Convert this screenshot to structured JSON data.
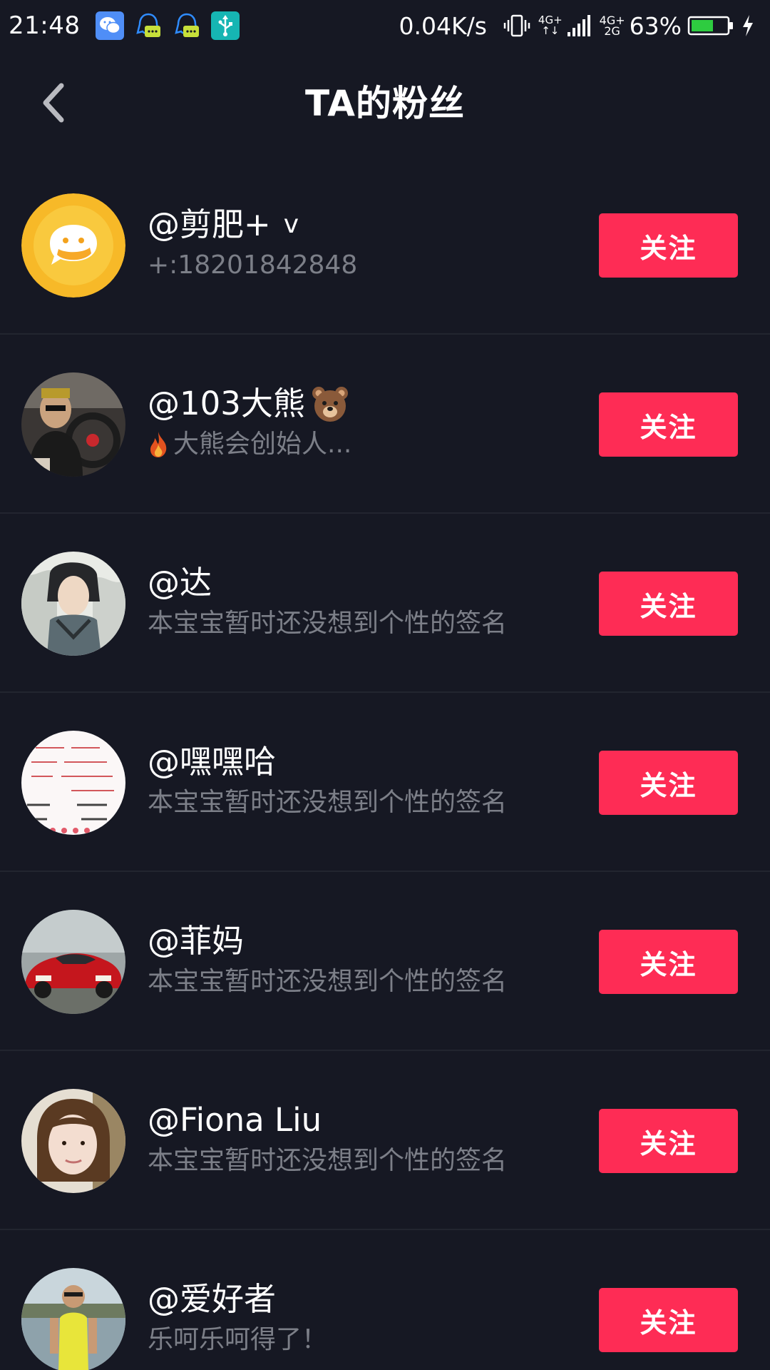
{
  "status_bar": {
    "time": "21:48",
    "network_speed": "0.04K/s",
    "net_type_1_top": "4G+",
    "net_type_1_bottom": "↑↓",
    "net_type_2_top": "4G+",
    "net_type_2_bottom": "2G",
    "battery_percent": "63%",
    "battery_level": 0.63,
    "icons": [
      "wechat-icon",
      "qq-icon",
      "qq-icon",
      "usb-icon",
      "vibrate-icon",
      "signal-icon",
      "signal-icon",
      "battery-icon",
      "charging-icon"
    ]
  },
  "header": {
    "title": "TA的粉丝",
    "back_icon": "chevron-left-icon"
  },
  "followers": [
    {
      "name": "@剪肥+",
      "verify": "v",
      "bio": "+:18201842848",
      "button": "关注",
      "avatar": "yellow-chat-logo"
    },
    {
      "name": "@103大熊",
      "bio": "大熊会创始人...",
      "button": "关注",
      "avatar": "man-in-car-photo",
      "name_suffix_icon": "bear-emoji",
      "bio_prefix_icon": "fire-emoji"
    },
    {
      "name": "@达",
      "bio": "本宝宝暂时还没想到个性的签名",
      "button": "关注",
      "avatar": "ink-portrait-photo"
    },
    {
      "name": "@嘿嘿哈",
      "bio": "本宝宝暂时还没想到个性的签名",
      "button": "关注",
      "avatar": "text-card-image"
    },
    {
      "name": "@菲妈",
      "bio": "本宝宝暂时还没想到个性的签名",
      "button": "关注",
      "avatar": "red-sports-car-photo"
    },
    {
      "name": "@Fiona Liu",
      "bio": "本宝宝暂时还没想到个性的签名",
      "button": "关注",
      "avatar": "woman-selfie-photo"
    },
    {
      "name": "@爱好者",
      "bio": "乐呵乐呵得了！",
      "button": "关注",
      "avatar": "man-by-lake-photo"
    }
  ],
  "colors": {
    "background": "#161823",
    "follow_button": "#fe2c55",
    "bio_text": "#7c7f88",
    "divider": "#22252f"
  }
}
